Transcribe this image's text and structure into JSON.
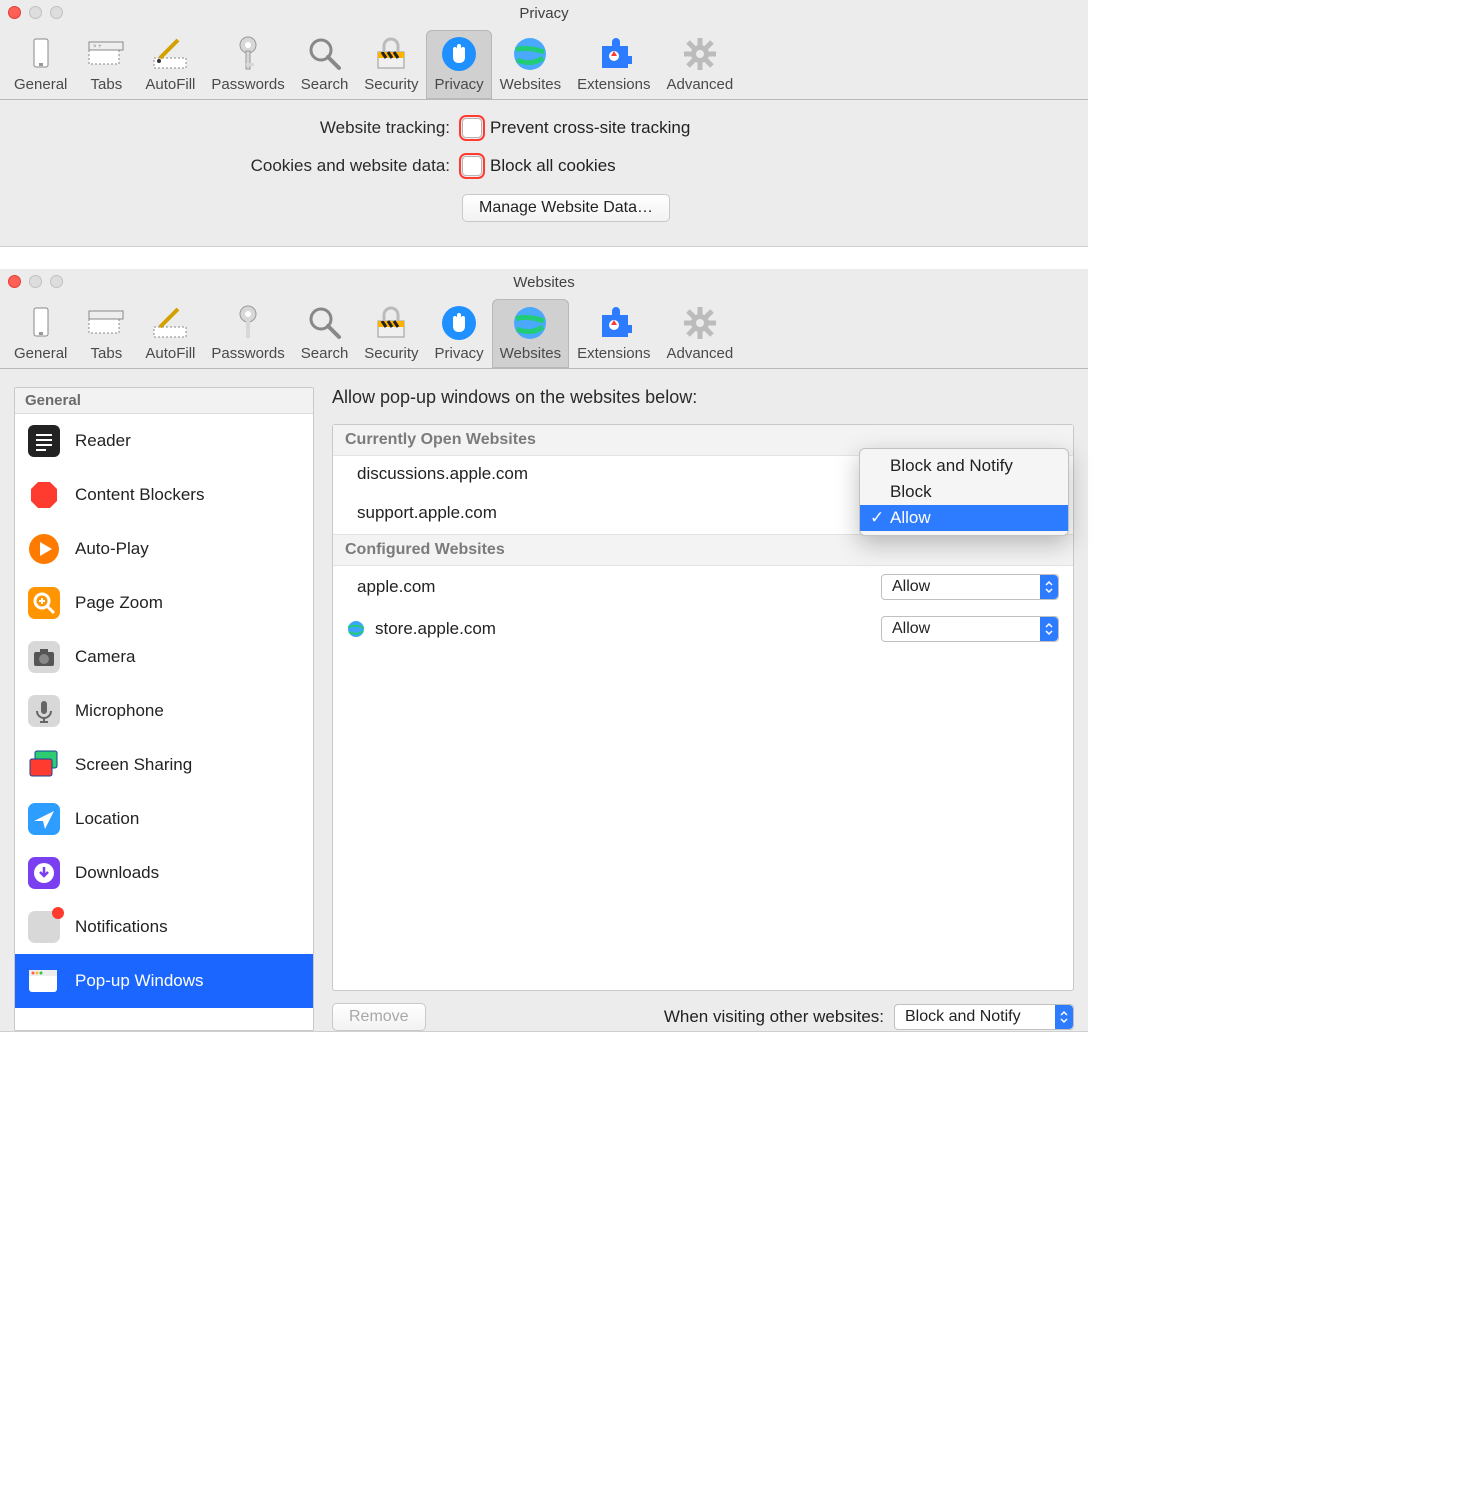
{
  "window1": {
    "title": "Privacy",
    "toolbar": [
      "General",
      "Tabs",
      "AutoFill",
      "Passwords",
      "Search",
      "Security",
      "Privacy",
      "Websites",
      "Extensions",
      "Advanced"
    ],
    "selected_tab": "Privacy",
    "rows": {
      "tracking_label": "Website tracking:",
      "tracking_text": "Prevent cross-site tracking",
      "cookies_label": "Cookies and website data:",
      "cookies_text": "Block all cookies",
      "manage_button": "Manage Website Data…"
    }
  },
  "window2": {
    "title": "Websites",
    "toolbar": [
      "General",
      "Tabs",
      "AutoFill",
      "Passwords",
      "Search",
      "Security",
      "Privacy",
      "Websites",
      "Extensions",
      "Advanced"
    ],
    "selected_tab": "Websites",
    "sidebar": {
      "header": "General",
      "items": [
        {
          "label": "Reader"
        },
        {
          "label": "Content Blockers"
        },
        {
          "label": "Auto-Play"
        },
        {
          "label": "Page Zoom"
        },
        {
          "label": "Camera"
        },
        {
          "label": "Microphone"
        },
        {
          "label": "Screen Sharing"
        },
        {
          "label": "Location"
        },
        {
          "label": "Downloads"
        },
        {
          "label": "Notifications"
        },
        {
          "label": "Pop-up Windows"
        }
      ],
      "selected": "Pop-up Windows"
    },
    "right": {
      "heading": "Allow pop-up windows on the websites below:",
      "sections": [
        {
          "title": "Currently Open Websites",
          "rows": [
            {
              "site": "discussions.apple.com",
              "value": "Allow",
              "icon": "apple"
            },
            {
              "site": "support.apple.com",
              "value": "Allow",
              "icon": "apple"
            }
          ]
        },
        {
          "title": "Configured Websites",
          "rows": [
            {
              "site": "apple.com",
              "value": "Allow",
              "icon": "apple"
            },
            {
              "site": "store.apple.com",
              "value": "Allow",
              "icon": "globe"
            }
          ]
        }
      ],
      "popup_options": [
        "Block and Notify",
        "Block",
        "Allow"
      ],
      "popup_selected": "Allow",
      "remove_button": "Remove",
      "other_label": "When visiting other websites:",
      "other_value": "Block and Notify"
    }
  }
}
